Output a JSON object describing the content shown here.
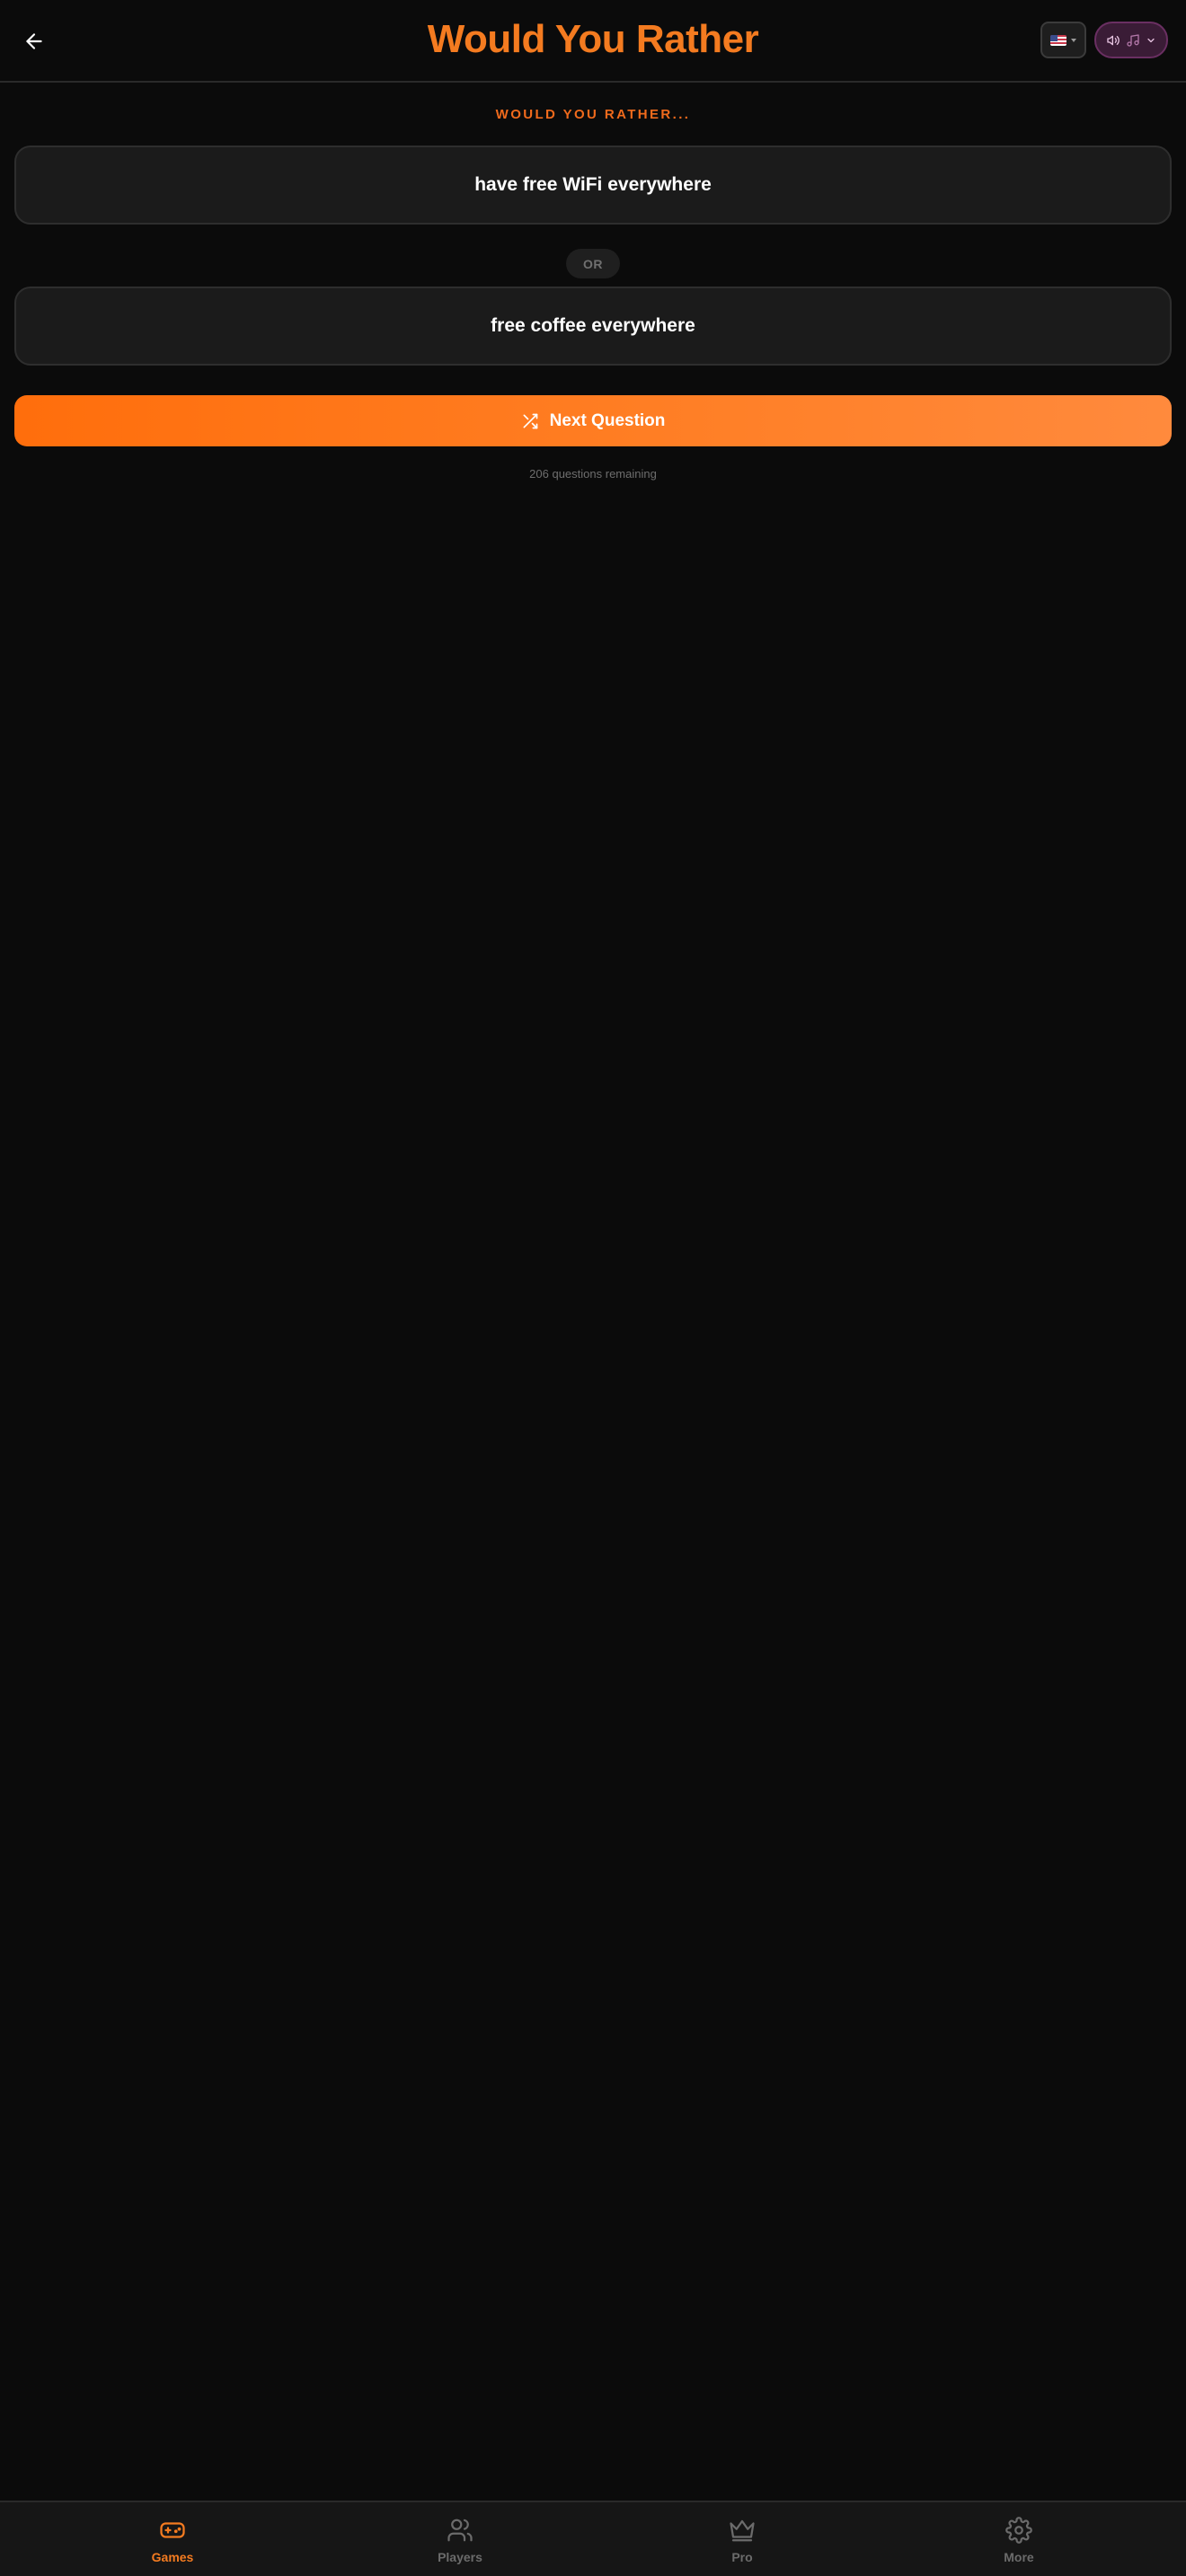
{
  "header": {
    "title": "Would You Rather",
    "back_icon": "arrow-left-icon",
    "language_icon": "us-flag-icon",
    "sound_icons": [
      "speaker-icon",
      "music-note-icon",
      "chevron-down-icon"
    ]
  },
  "game": {
    "prompt_label": "WOULD YOU RATHER...",
    "option_a": "have free WiFi everywhere",
    "or_label": "OR",
    "option_b": "free coffee everywhere",
    "next_button_label": "Next Question",
    "next_button_icon": "shuffle-icon",
    "remaining_text": "206 questions remaining"
  },
  "nav": {
    "items": [
      {
        "label": "Games",
        "icon": "gamepad-icon",
        "active": true
      },
      {
        "label": "Players",
        "icon": "users-icon",
        "active": false
      },
      {
        "label": "Pro",
        "icon": "crown-icon",
        "active": false
      },
      {
        "label": "More",
        "icon": "gear-icon",
        "active": false
      }
    ]
  },
  "colors": {
    "background": "#0b0b0b",
    "accent": "#f47b20",
    "card": "#1b1b1b",
    "muted_text": "#6e6e6e",
    "sound_toggle": "#3a1c36"
  }
}
